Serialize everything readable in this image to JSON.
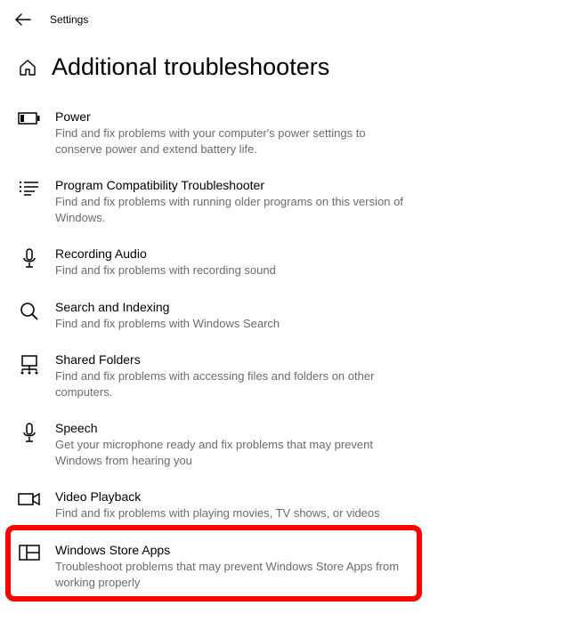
{
  "header": {
    "label": "Settings"
  },
  "page_title": "Additional troubleshooters",
  "items": [
    {
      "title": "Power",
      "desc": "Find and fix problems with your computer's power settings to conserve power and extend battery life."
    },
    {
      "title": "Program Compatibility Troubleshooter",
      "desc": "Find and fix problems with running older programs on this version of Windows."
    },
    {
      "title": "Recording Audio",
      "desc": "Find and fix problems with recording sound"
    },
    {
      "title": "Search and Indexing",
      "desc": "Find and fix problems with Windows Search"
    },
    {
      "title": "Shared Folders",
      "desc": "Find and fix problems with accessing files and folders on other computers."
    },
    {
      "title": "Speech",
      "desc": "Get your microphone ready and fix problems that may prevent Windows from hearing you"
    },
    {
      "title": "Video Playback",
      "desc": "Find and fix problems with playing movies, TV shows, or videos"
    },
    {
      "title": "Windows Store Apps",
      "desc": "Troubleshoot problems that may prevent Windows Store Apps from working properly"
    }
  ]
}
